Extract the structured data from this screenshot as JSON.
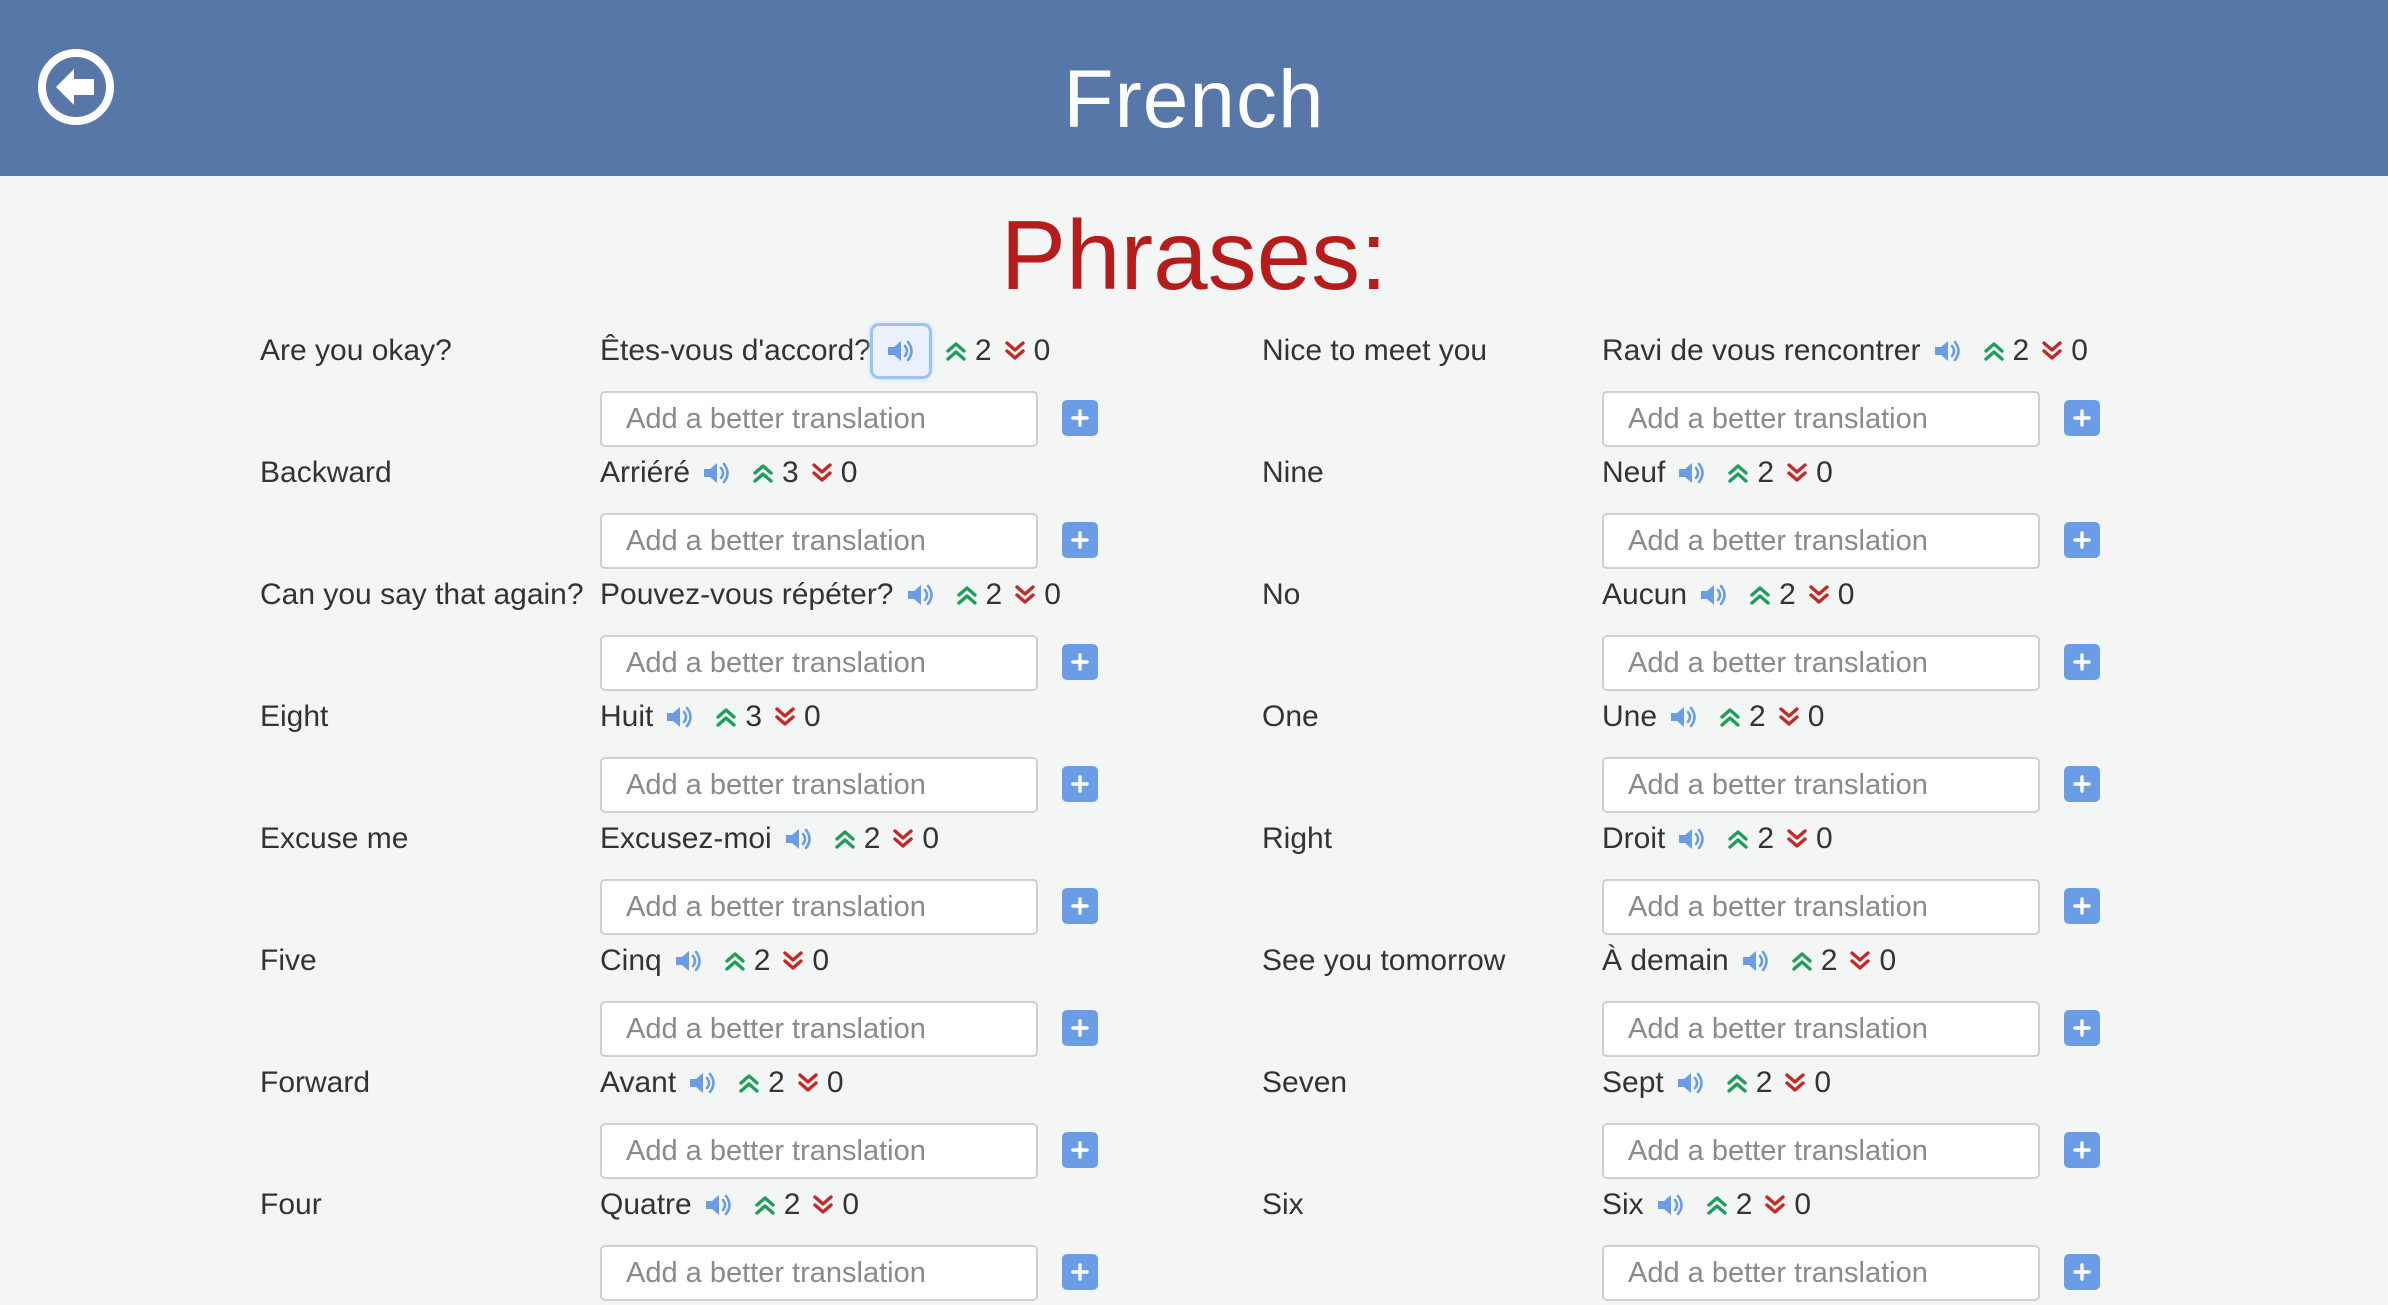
{
  "header": {
    "title": "French",
    "back_icon": "back-arrow-circle-icon"
  },
  "section_title": "Phrases:",
  "input_placeholder": "Add a better translation",
  "colors": {
    "header_bg": "#5677a8",
    "section_title": "#b71c1c",
    "upvote": "#1e9e5a",
    "downvote": "#c62828",
    "accent": "#6b9de6"
  },
  "left_column": [
    {
      "english": "Are you okay?",
      "translation": "Êtes-vous d'accord?",
      "up": "2",
      "down": "0",
      "speaker_focused": true
    },
    {
      "english": "Backward",
      "translation": "Arriéré",
      "up": "3",
      "down": "0"
    },
    {
      "english": "Can you say that again?",
      "translation": "Pouvez-vous répéter?",
      "up": "2",
      "down": "0"
    },
    {
      "english": "Eight",
      "translation": "Huit",
      "up": "3",
      "down": "0"
    },
    {
      "english": "Excuse me",
      "translation": "Excusez-moi",
      "up": "2",
      "down": "0"
    },
    {
      "english": "Five",
      "translation": "Cinq",
      "up": "2",
      "down": "0"
    },
    {
      "english": "Forward",
      "translation": "Avant",
      "up": "2",
      "down": "0"
    },
    {
      "english": "Four",
      "translation": "Quatre",
      "up": "2",
      "down": "0"
    }
  ],
  "right_column": [
    {
      "english": "Nice to meet you",
      "translation": "Ravi de vous rencontrer",
      "up": "2",
      "down": "0"
    },
    {
      "english": "Nine",
      "translation": "Neuf",
      "up": "2",
      "down": "0"
    },
    {
      "english": "No",
      "translation": "Aucun",
      "up": "2",
      "down": "0"
    },
    {
      "english": "One",
      "translation": "Une",
      "up": "2",
      "down": "0"
    },
    {
      "english": "Right",
      "translation": "Droit",
      "up": "2",
      "down": "0"
    },
    {
      "english": "See you tomorrow",
      "translation": "À demain",
      "up": "2",
      "down": "0"
    },
    {
      "english": "Seven",
      "translation": "Sept",
      "up": "2",
      "down": "0"
    },
    {
      "english": "Six",
      "translation": "Six",
      "up": "2",
      "down": "0"
    }
  ]
}
